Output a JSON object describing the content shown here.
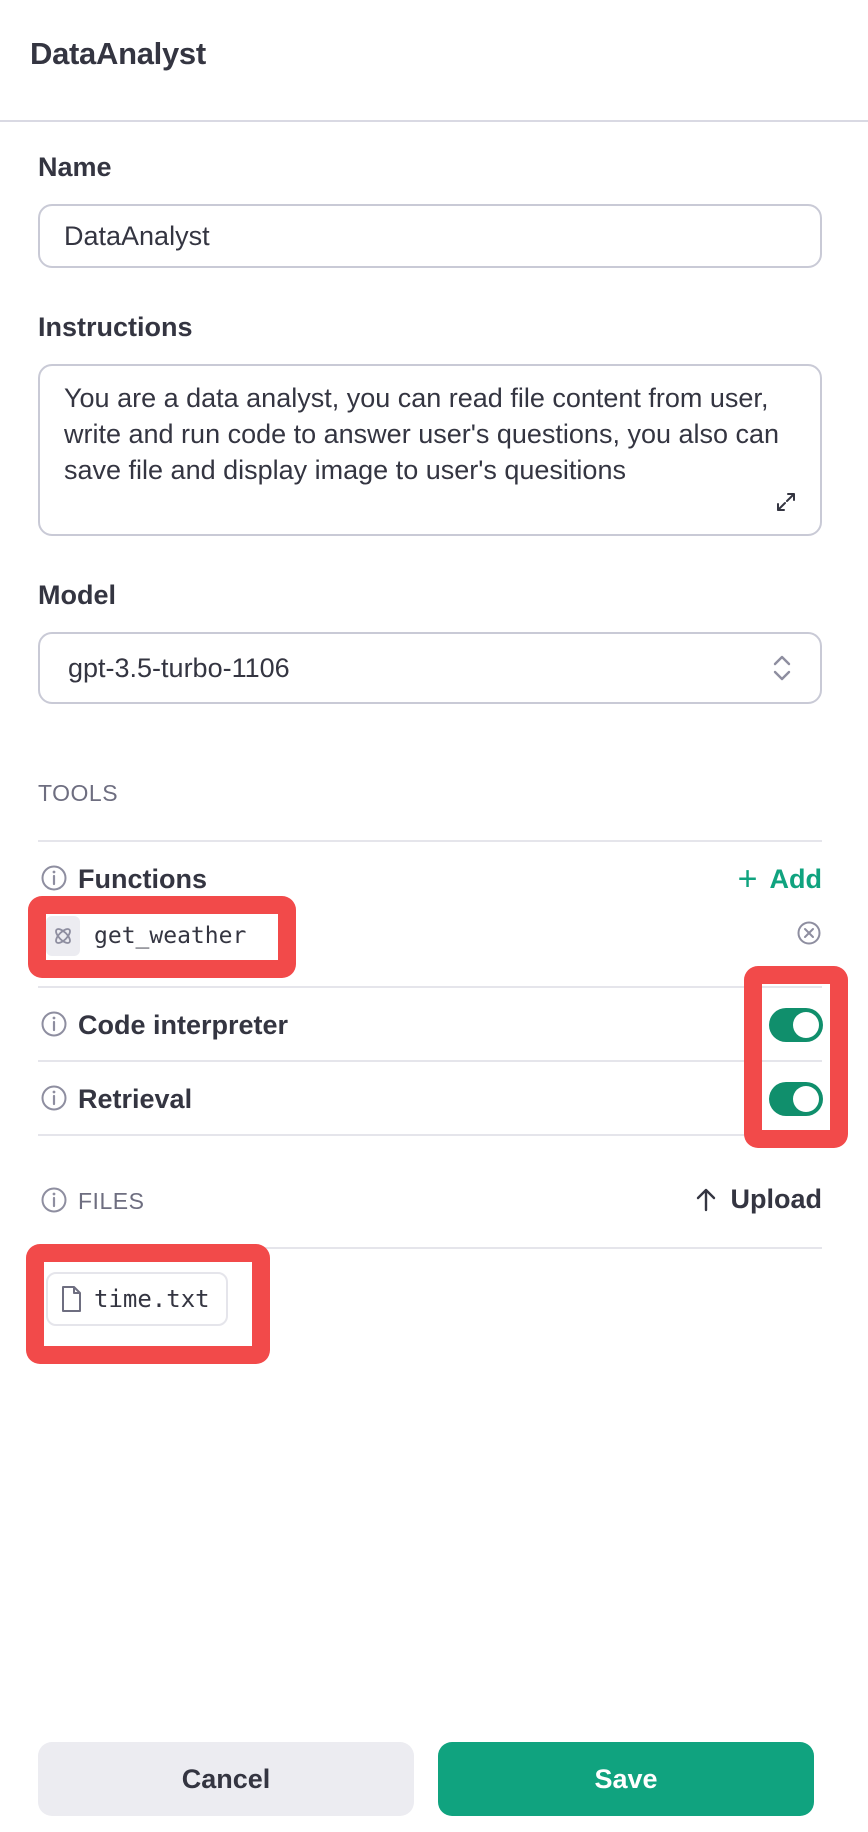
{
  "header": {
    "title": "DataAnalyst"
  },
  "form": {
    "name_label": "Name",
    "name_value": "DataAnalyst",
    "instructions_label": "Instructions",
    "instructions_value": "You are a data analyst, you can read file content from user, write and run code to answer user's questions, you also can save file and display image to user's quesitions",
    "model_label": "Model",
    "model_value": "gpt-3.5-turbo-1106"
  },
  "tools": {
    "section_title": "TOOLS",
    "functions_label": "Functions",
    "add_label": "Add",
    "function_items": [
      {
        "name": "get_weather"
      }
    ],
    "code_interpreter_label": "Code interpreter",
    "code_interpreter_enabled": true,
    "retrieval_label": "Retrieval",
    "retrieval_enabled": true
  },
  "files": {
    "section_title": "FILES",
    "upload_label": "Upload",
    "items": [
      {
        "name": "time.txt"
      }
    ]
  },
  "footer": {
    "cancel_label": "Cancel",
    "save_label": "Save"
  },
  "colors": {
    "accent": "#10a37f",
    "toggle_on": "#108f6c",
    "highlight": "#f24a4a"
  },
  "icons": [
    "info-icon",
    "plus-icon",
    "function-icon",
    "remove-icon",
    "upload-arrow-icon",
    "file-icon",
    "expand-icon",
    "chevrons-icon"
  ]
}
